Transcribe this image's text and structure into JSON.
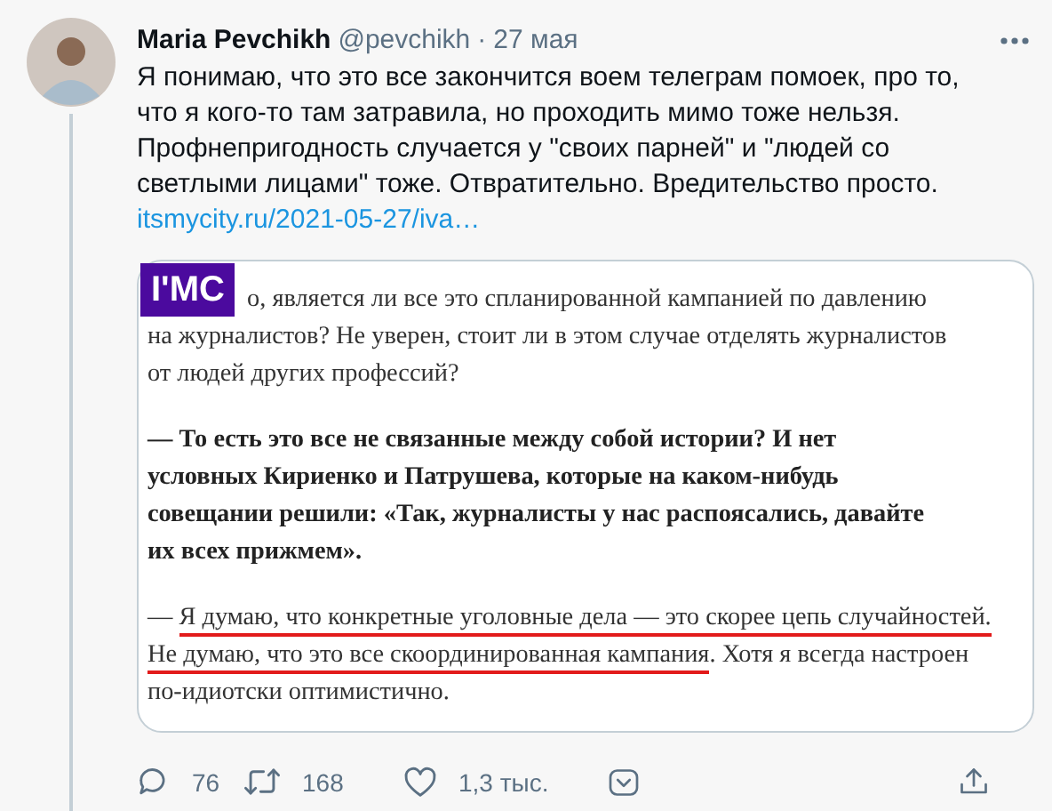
{
  "tweet": {
    "author_name": "Maria Pevchikh",
    "handle": "@pevchikh",
    "separator": "·",
    "date": "27 мая",
    "text": "Я понимаю, что это все закончится воем телеграм помоек, про то, что я кого-то там затравила, но проходить мимо тоже нельзя. Профнепригодность случается у \"своих парней\" и \"людей со светлыми лицами\" тоже. Отвратительно. Вредительство просто.",
    "link": "itsmycity.ru/2021-05-27/iva…",
    "attachment": {
      "logo": "I'MC",
      "paragraphs": [
        {
          "bold": false,
          "lines": [
            [
              {
                "text": "о, является ли все это спланированной кампанией по давлению",
                "underlined": false
              }
            ],
            [
              {
                "text": "на журналистов? Не уверен, стоит ли в этом случае отделять журналистов",
                "underlined": false
              }
            ],
            [
              {
                "text": "от людей других профессий?",
                "underlined": false
              }
            ]
          ]
        },
        {
          "bold": true,
          "lines": [
            [
              {
                "text": "— То есть это все не связанные между собой истории? И нет",
                "underlined": false
              }
            ],
            [
              {
                "text": "условных Кириенко и Патрушева, которые на каком-нибудь",
                "underlined": false
              }
            ],
            [
              {
                "text": "совещании решили: «Так, журналисты у нас распоясались, давайте",
                "underlined": false
              }
            ],
            [
              {
                "text": "их всех прижмем».",
                "underlined": false
              }
            ]
          ]
        },
        {
          "bold": false,
          "lines": [
            [
              {
                "text": "— ",
                "underlined": false
              },
              {
                "text": "Я думаю, что конкретные уголовные дела — это скорее цепь случайностей.",
                "underlined": true
              }
            ],
            [
              {
                "text": "Не думаю, что это все скоординированная кампания",
                "underlined": true
              },
              {
                "text": ". Хотя я всегда настроен",
                "underlined": false
              }
            ],
            [
              {
                "text": "по-идиотски оптимистично.",
                "underlined": false
              }
            ]
          ]
        }
      ]
    },
    "actions": [
      {
        "kind": "reply",
        "count": "76"
      },
      {
        "kind": "retweet",
        "count": "168"
      },
      {
        "kind": "like",
        "count": "1,3 тыс."
      },
      {
        "kind": "save"
      },
      {
        "kind": "share"
      }
    ]
  }
}
